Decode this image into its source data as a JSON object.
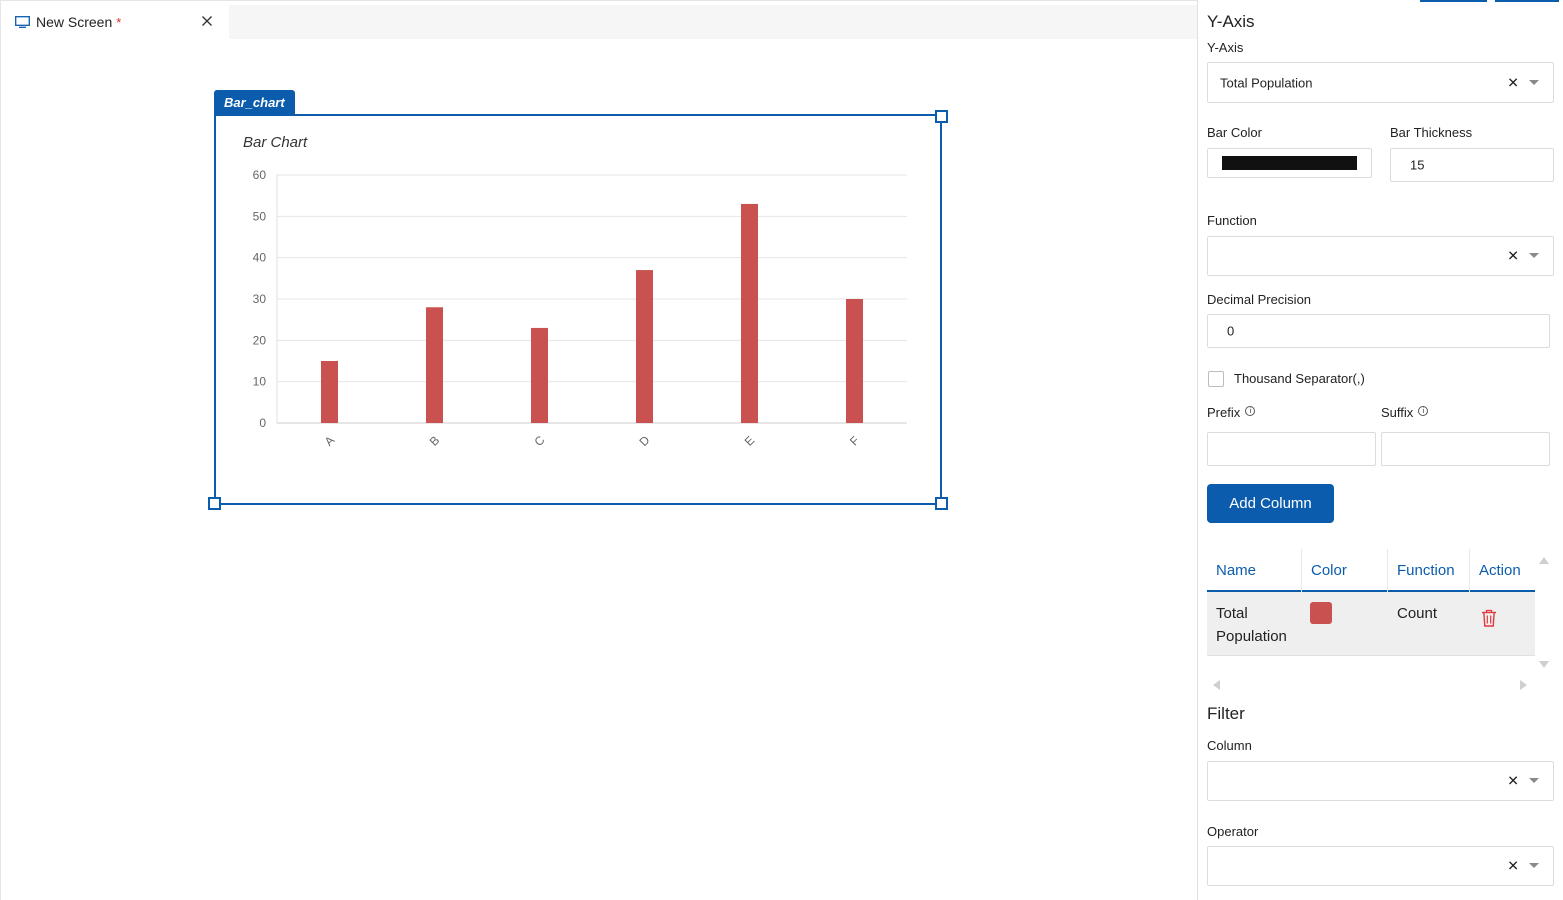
{
  "tab": {
    "title": "New Screen",
    "modified_mark": "*"
  },
  "widget": {
    "tag": "Bar_chart"
  },
  "chart_data": {
    "type": "bar",
    "title": "Bar Chart",
    "categories": [
      "A",
      "B",
      "C",
      "D",
      "E",
      "F"
    ],
    "values": [
      15,
      28,
      23,
      37,
      53,
      30
    ],
    "ylim": [
      0,
      60
    ],
    "yticks": [
      0,
      10,
      20,
      30,
      40,
      50,
      60
    ],
    "xlabel": "",
    "ylabel": "",
    "grid": true,
    "bar_color": "#c9514f"
  },
  "panel": {
    "title": "Y-Axis",
    "yaxis_label": "Y-Axis",
    "yaxis_value": "Total Population",
    "bar_color_label": "Bar Color",
    "bar_color_value": "#111111",
    "bar_thickness_label": "Bar Thickness",
    "bar_thickness_value": "15",
    "function_label": "Function",
    "function_value": "",
    "decimal_label": "Decimal Precision",
    "decimal_value": "0",
    "thousand_label": "Thousand Separator(,)",
    "prefix_label": "Prefix",
    "suffix_label": "Suffix",
    "add_column_label": "Add Column",
    "table": {
      "headers": [
        "Name",
        "Color",
        "Function",
        "Action"
      ],
      "rows": [
        {
          "name_line1": "Total",
          "name_line2": "Population",
          "color": "#c9514f",
          "function": "Count"
        }
      ]
    },
    "filter_title": "Filter",
    "column_label": "Column",
    "operator_label": "Operator",
    "accent_color": "#0b5cad"
  }
}
